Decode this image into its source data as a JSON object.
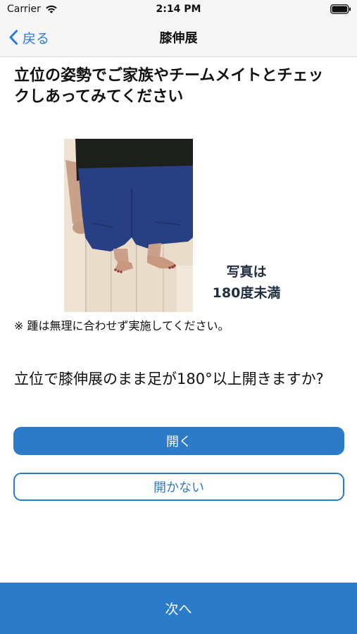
{
  "status_bar": {
    "carrier": "Carrier",
    "time": "2:14 PM"
  },
  "nav": {
    "back_label": "戻る",
    "title": "膝伸展"
  },
  "main": {
    "heading": "立位の姿勢でご家族やチームメイトとチェックしあってみてください",
    "photo_caption_line1": "写真は",
    "photo_caption_line2": "180度未満",
    "note": "※ 踵は無理に合わせず実施してください。",
    "question": "立位で膝伸展のまま足が180°以上開きますか?",
    "open_button": "開く",
    "not_open_button": "開かない"
  },
  "footer": {
    "next_label": "次へ"
  },
  "colors": {
    "accent": "#2c7bc8",
    "nav_tint": "#2b7bd6",
    "caption": "#1f2f40"
  },
  "icons": {
    "wifi": "wifi-icon",
    "battery": "battery-icon",
    "back": "chevron-left-icon"
  }
}
